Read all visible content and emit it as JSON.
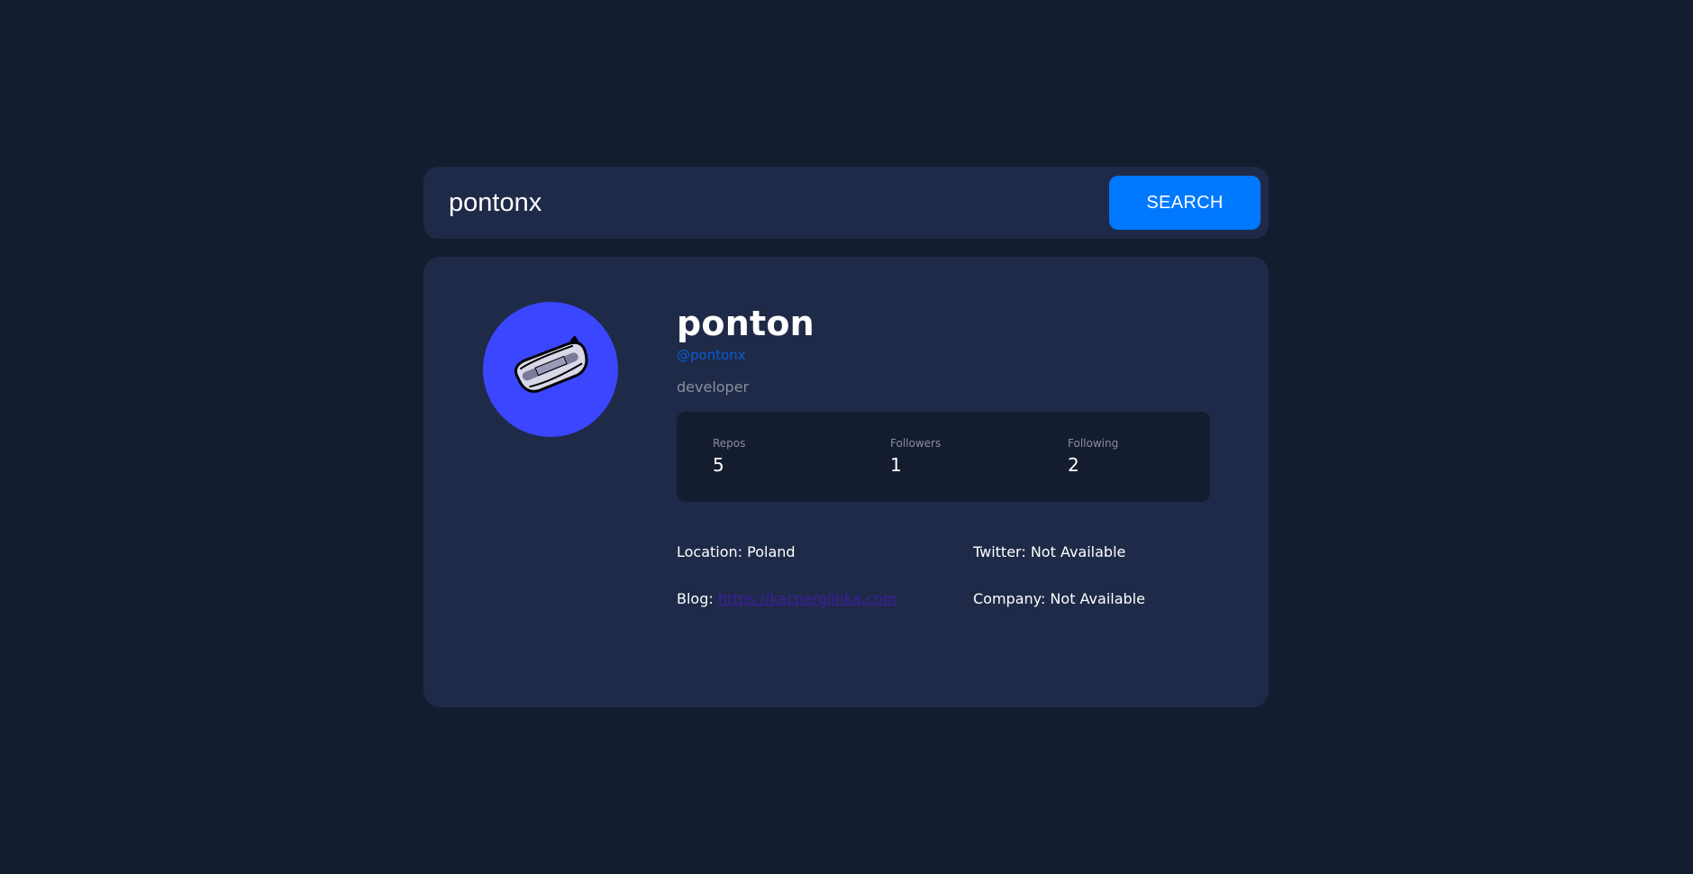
{
  "search": {
    "value": "pontonx",
    "button_label": "SEARCH"
  },
  "profile": {
    "name": "ponton",
    "login": "@pontonx",
    "bio": "developer",
    "avatar_icon": "inflatable-boat-icon",
    "avatar_bg": "#3b46ff"
  },
  "stats": [
    {
      "label": "Repos",
      "value": "5"
    },
    {
      "label": "Followers",
      "value": "1"
    },
    {
      "label": "Following",
      "value": "2"
    }
  ],
  "info": {
    "location": "Location: Poland",
    "twitter": "Twitter: Not Available",
    "blog_label": "Blog:",
    "blog_url": "https://kacperglinka.com",
    "company": "Company: Not Available"
  },
  "colors": {
    "background": "#141c2f",
    "card": "#1f2a48",
    "accent": "#0079ff"
  }
}
